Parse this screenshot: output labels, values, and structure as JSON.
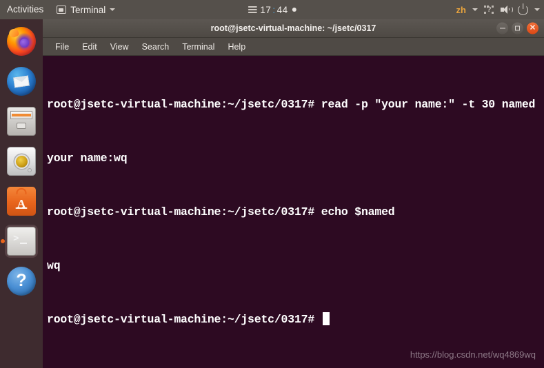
{
  "top_bar": {
    "activities_label": "Activities",
    "app_menu_label": "Terminal",
    "app_menu_icon": "terminal-icon",
    "clock": {
      "hours": "17",
      "separator": ":",
      "minutes": "44",
      "menu_icon": "hamburger-icon",
      "notification_dot": true
    },
    "tray": {
      "language_indicator": "zh",
      "keyboard_icon": "keyboard-question-icon",
      "volume_icon": "speaker-icon",
      "power_icon": "power-icon"
    }
  },
  "dock": {
    "items": [
      {
        "name": "firefox",
        "label": "Firefox Web Browser",
        "active": false
      },
      {
        "name": "thunderbird",
        "label": "Thunderbird Mail",
        "active": false
      },
      {
        "name": "files",
        "label": "Files",
        "active": false
      },
      {
        "name": "rhythmbox",
        "label": "Rhythmbox",
        "active": false
      },
      {
        "name": "ubuntu-software",
        "label": "Ubuntu Software",
        "active": false
      },
      {
        "name": "terminal",
        "label": "Terminal",
        "active": true
      },
      {
        "name": "help",
        "label": "Help",
        "active": false
      }
    ]
  },
  "window": {
    "title": "root@jsetc-virtual-machine: ~/jsetc/0317",
    "controls": {
      "minimize": "minimize-button",
      "maximize": "maximize-button",
      "close": "close-button"
    },
    "menu": [
      {
        "label": "File"
      },
      {
        "label": "Edit"
      },
      {
        "label": "View"
      },
      {
        "label": "Search"
      },
      {
        "label": "Terminal"
      },
      {
        "label": "Help"
      }
    ]
  },
  "terminal": {
    "background_color": "#2D0A22",
    "text_color": "#FFFFFF",
    "lines": [
      "root@jsetc-virtual-machine:~/jsetc/0317# read -p \"your name:\" -t 30 named",
      "your name:wq",
      "root@jsetc-virtual-machine:~/jsetc/0317# echo $named",
      "wq",
      "root@jsetc-virtual-machine:~/jsetc/0317# "
    ],
    "prompt": "root@jsetc-virtual-machine:~/jsetc/0317#",
    "cursor_visible": true
  },
  "watermark": {
    "text": "https://blog.csdn.net/wq4869wq"
  }
}
